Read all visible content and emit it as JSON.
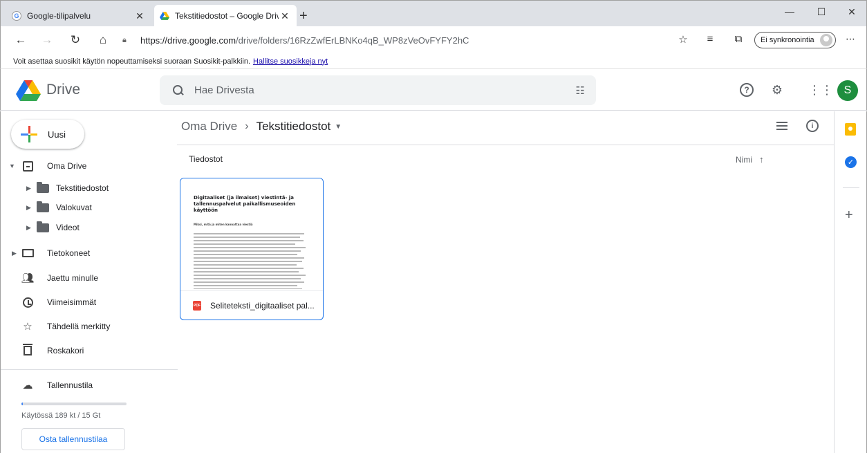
{
  "browser": {
    "tabs": [
      {
        "title": "Google-tilipalvelu",
        "favicon": "google-icon",
        "active": false
      },
      {
        "title": "Tekstitiedostot – Google Drive",
        "favicon": "drive-icon",
        "active": true
      }
    ],
    "address": {
      "host": "https://drive.google.com",
      "path": "/drive/folders/16RzZwfErLBNKo4qB_WP8zVeOvFYFY2hC"
    },
    "sync_label": "Ei synkronointia",
    "favorites_bar": {
      "message": "Voit asettaa suosikit käytön nopeuttamiseksi suoraan Suosikit-palkkiin.",
      "link": "Hallitse suosikkeja nyt"
    }
  },
  "header": {
    "app_name": "Drive",
    "search_placeholder": "Hae Drivesta",
    "avatar_letter": "S",
    "avatar_color": "#1e8e3e"
  },
  "sidebar": {
    "new_label": "Uusi",
    "my_drive": "Oma Drive",
    "folders": [
      "Tekstitiedostot",
      "Valokuvat",
      "Videot"
    ],
    "computers": "Tietokoneet",
    "shared": "Jaettu minulle",
    "recent": "Viimeisimmät",
    "starred": "Tähdellä merkitty",
    "trash": "Roskakori",
    "storage": "Tallennustila",
    "storage_usage": "Käytössä 189 kt / 15 Gt",
    "storage_fraction": 0.01,
    "buy_storage": "Osta tallennustilaa"
  },
  "main": {
    "breadcrumb_root": "Oma Drive",
    "breadcrumb_current": "Tekstitiedostot",
    "section_title": "Tiedostot",
    "sort_label": "Nimi",
    "files": [
      {
        "name": "Seliteteksti_digitaaliset pal...",
        "type": "PDF",
        "preview_title": "Digitaaliset (ja ilmaiset) viestintä- ja tallennuspalvelut paikallismuseoiden käyttöön",
        "preview_subtitle": "Miksi, mitä ja miten kannattaa viestiä"
      }
    ]
  },
  "colors": {
    "accent": "#1a73e8",
    "pdf_red": "#ea4335"
  }
}
